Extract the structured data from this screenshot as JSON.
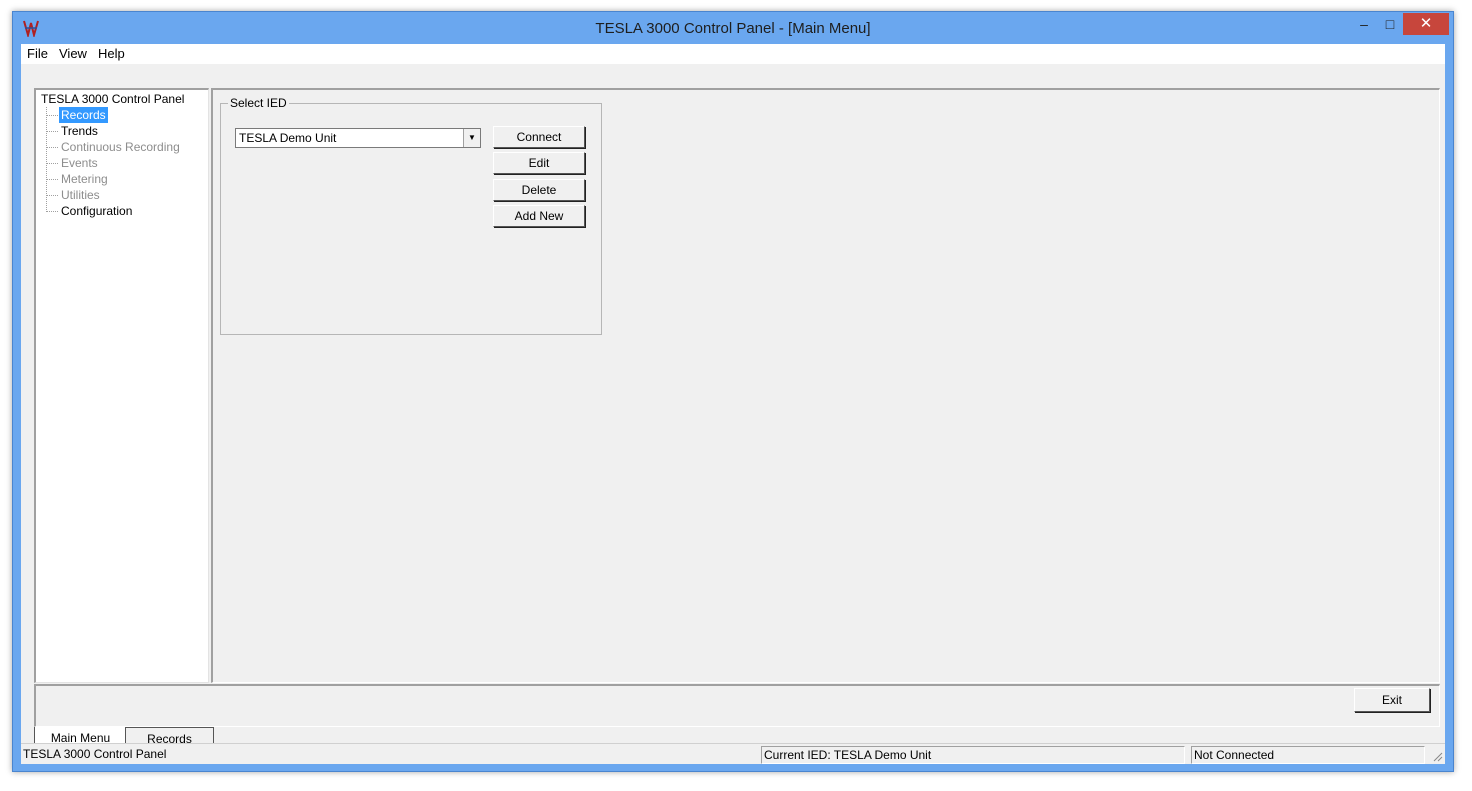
{
  "window": {
    "title": "TESLA 3000 Control Panel - [Main Menu]",
    "controls": {
      "minimize": "–",
      "maximize": "□",
      "close": "✕"
    }
  },
  "menubar": {
    "items": [
      "File",
      "View",
      "Help"
    ]
  },
  "tree": {
    "root": "TESLA 3000 Control Panel",
    "items": [
      {
        "label": "Records",
        "state": "selected"
      },
      {
        "label": "Trends",
        "state": "enabled"
      },
      {
        "label": "Continuous Recording",
        "state": "disabled"
      },
      {
        "label": "Events",
        "state": "disabled"
      },
      {
        "label": "Metering",
        "state": "disabled"
      },
      {
        "label": "Utilities",
        "state": "disabled"
      },
      {
        "label": "Configuration",
        "state": "enabled"
      }
    ]
  },
  "select_ied": {
    "group_label": "Select IED",
    "selected_value": "TESLA Demo Unit",
    "buttons": {
      "connect": "Connect",
      "edit": "Edit",
      "delete": "Delete",
      "add_new": "Add New"
    }
  },
  "footer": {
    "exit_label": "Exit"
  },
  "tabs": [
    {
      "label": "Main Menu",
      "active": true
    },
    {
      "label": "Records",
      "active": false
    }
  ],
  "status": {
    "app_name": "TESLA 3000 Control Panel",
    "current_ied": "Current IED:  TESLA Demo Unit",
    "connection": "Not Connected"
  },
  "colors": {
    "titlebar": "#6aa7ef",
    "close_button": "#c7463c",
    "selection": "#3399ff",
    "face": "#f0f0f0"
  }
}
